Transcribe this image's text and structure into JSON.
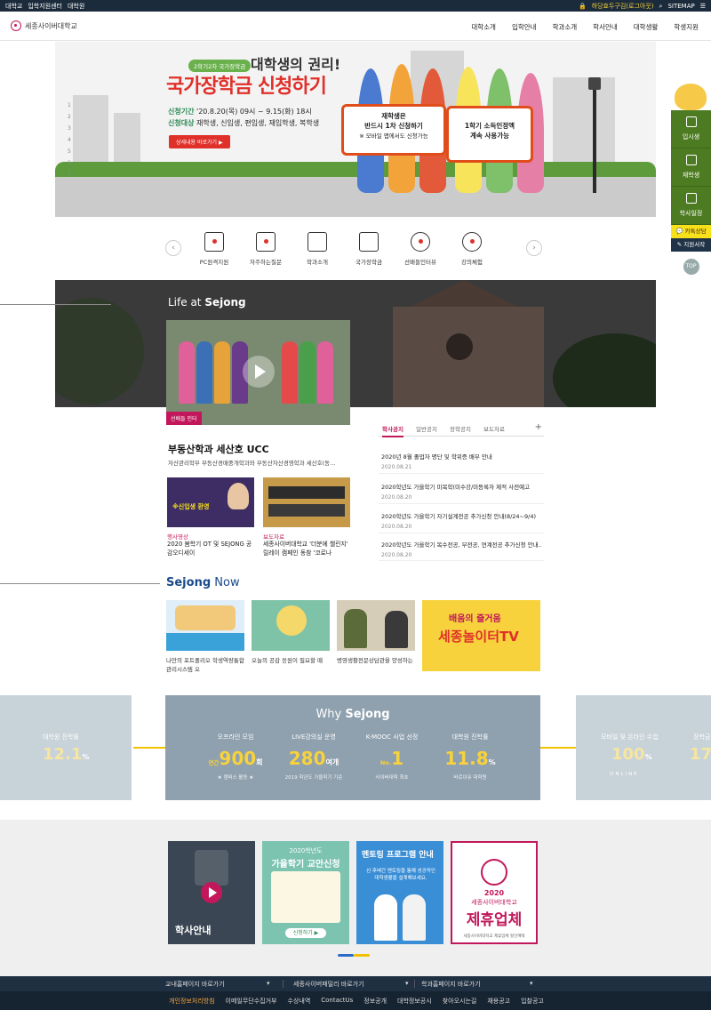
{
  "topbar": {
    "links": [
      "대학교",
      "입학지원센터",
      "대학원"
    ],
    "login": "하당효두구김(로그아웃)",
    "sitemap": "SITEMAP"
  },
  "header": {
    "logo_text": "세종사이버대학교",
    "nav": [
      "대학소개",
      "입학안내",
      "학과소개",
      "학사안내",
      "대학생활",
      "학생지원"
    ]
  },
  "hero": {
    "tag": "2학기2차 국가장학금",
    "title1": "대학생의 권리!",
    "title2": "국가장학금 신청하기",
    "period_label": "신청기간",
    "period": "'20.8.20(목) 09시 ~ 9.15(화) 18시",
    "target_label": "신청대상",
    "target": "재학생, 신입생, 편입생, 재입학생, 복학생",
    "cta": "상세내용 바로가기 ▶",
    "sign1_line1": "재학생은",
    "sign1_line2": "반드시 1차 신청하기",
    "sign1_line3": "※ 모바일 앱에서도 신청가능",
    "sign2_line1": "1학기 소득인정액",
    "sign2_line2": "계속 사용가능",
    "pager": [
      "1",
      "2",
      "3",
      "4",
      "5",
      "6",
      "7"
    ]
  },
  "quick_menu": [
    {
      "label": "PC원격지원"
    },
    {
      "label": "자주하는질문"
    },
    {
      "label": "학과소개"
    },
    {
      "label": "국가장학금"
    },
    {
      "label": "선배들인터뷰"
    },
    {
      "label": "강의체험"
    }
  ],
  "side": {
    "items": [
      "입시생",
      "재학생",
      "학사일정"
    ],
    "kakao": "카톡상담",
    "apply": "지원서작",
    "top": "TOP"
  },
  "life": {
    "title_prefix": "Life at",
    "title_bold": "Sejong",
    "video_badge": "선배들 인터",
    "main_title": "부동산학과 세산호 UCC",
    "main_desc": "자산관리학부 부동산경매중개학과와 부동산자산경영학과 세산호(동...",
    "thumb1_text": "※신입생 환영",
    "items": [
      {
        "category": "행사영상",
        "title": "2020 봄학기 OT 및 SEJONG 공감오디세이"
      },
      {
        "category": "보도자료",
        "title": "세종사이버대학교 '더분에 챌린지' 릴레이 캠페인 동참 '코로나"
      }
    ]
  },
  "notice": {
    "tabs": [
      "학사공지",
      "일반공지",
      "장학공지",
      "보도자료"
    ],
    "plus": "+",
    "items": [
      {
        "title": "2020년 8월 졸업자 명단 및 학위증 배부 안내",
        "date": "2020.08.21"
      },
      {
        "title": "2020학년도 가을학기 미복학(미수강/미등록자 제적 사전예고",
        "date": "2020.08.20"
      },
      {
        "title": "2020학년도 가을학기 자기설계전공 추가신청 안내(8/24~9/4)",
        "date": "2020.08.20"
      },
      {
        "title": "2020학년도 가을학기 복수전공, 부전공, 연계전공 추가신청 안내...",
        "date": "2020.08.20"
      }
    ]
  },
  "now": {
    "title_bold": "Sejong",
    "title_rest": "Now",
    "items": [
      {
        "caption": "나만의 포트폴리오 학생역량통합관리시스템 오"
      },
      {
        "caption": "오늘의 공감 응원이 필요할 때"
      },
      {
        "caption": "병영생활전문상담관을 양성하는"
      }
    ],
    "yellow_line1": "배움의 즐거움",
    "yellow_line2": "세종놀이터TV"
  },
  "why": {
    "title_prefix": "Why",
    "title_bold": "Sejong",
    "stats": [
      {
        "label": "오프라인 모임",
        "pre": "연간",
        "value": "900",
        "unit": "회",
        "caption": "★ 캠퍼스 활동 ★"
      },
      {
        "label": "LIVE강의실 운영",
        "pre": "",
        "value": "280",
        "unit": "여개",
        "caption": "2019 학년도 가을학기 기준"
      },
      {
        "label": "K-MOOC 사업 선정",
        "pre": "No.",
        "value": "1",
        "unit": "",
        "caption": "사이버대학 최초"
      },
      {
        "label": "대학원 진학률",
        "pre": "",
        "value": "11.8",
        "unit": "%",
        "caption": "바로이유 대학원"
      }
    ],
    "left_label": "대학원 진학률",
    "left_value": "12.1",
    "left_unit": "%",
    "right_label": "모바일 및 온라인 수업",
    "right_value": "100",
    "right_unit": "%",
    "right_caption": "ONLINE",
    "far_right_label": "장학금",
    "far_right_value": "17"
  },
  "cards": {
    "card1_title": "학사안내",
    "card2_sub": "2020학년도",
    "card2_title": "가을학기 교안신청",
    "card2_btn": "신청하기 ▶",
    "card3_title": "멘토링 프로그램 안내",
    "card3_desc": "선·후배간 멘토링을 통해 성공적인 대학생활을 설계해보세요.",
    "card4_year": "2020",
    "card4_name": "세종사이버대학교",
    "card4_title": "제휴업체",
    "card4_foot": "세종사이버대학교 제휴업체 할인혜택"
  },
  "footer": {
    "selects": [
      "교내홈페이지 바로가기",
      "세종사이버패밀리 바로가기",
      "학과홈페이지 바로가기"
    ],
    "links": [
      "개인정보처리방침",
      "이메일무단수집거부",
      "수상내역",
      "ContactUs",
      "정보공개",
      "대학정보공시",
      "찾아오시는길",
      "채용공고",
      "입찰공고"
    ]
  }
}
